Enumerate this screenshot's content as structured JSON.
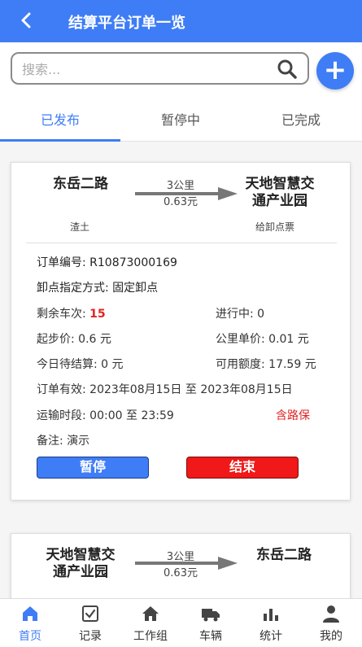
{
  "header": {
    "back_icon": "chevron-left-icon",
    "title": "结算平台订单一览"
  },
  "search": {
    "placeholder": "搜索...",
    "value": ""
  },
  "tabs": [
    {
      "label": "已发布",
      "active": true
    },
    {
      "label": "暂停中",
      "active": false
    },
    {
      "label": "已完成",
      "active": false
    }
  ],
  "orders": [
    {
      "from": "东岳二路",
      "to_line1": "天地智慧交",
      "to_line2": "通产业园",
      "distance_km": "3公里",
      "price": "0.63元",
      "cargo": "渣土",
      "ticket": "给卸点票",
      "order_no_label": "订单编号:",
      "order_no": "R10873000169",
      "unload_label": "卸点指定方式:",
      "unload_mode": "固定卸点",
      "remaining_label": "剩余车次:",
      "remaining": "15",
      "ongoing_label": "进行中:",
      "ongoing": "0",
      "start_price_label": "起步价:",
      "start_price": "0.6 元",
      "unit_price_label": "公里单价:",
      "unit_price": "0.01 元",
      "today_label": "今日待结算:",
      "today": "0 元",
      "quota_label": "可用额度:",
      "quota": "17.59 元",
      "valid_label": "订单有效:",
      "valid_from": "2023年08月15日",
      "to_word": "至",
      "valid_to": "2023年08月15日",
      "period_label": "运输时段:",
      "period_from": "00:00",
      "period_to": "23:59",
      "insurance": "含路保",
      "remark_label": "备注:",
      "remark": "演示",
      "pause_button": "暂停",
      "end_button": "结束"
    },
    {
      "from_line1": "天地智慧交",
      "from_line2": "通产业园",
      "to": "东岳二路",
      "distance_km": "3公里",
      "price": "0.63元"
    }
  ],
  "bottom_nav": [
    {
      "label": "首页",
      "icon": "home-icon",
      "active": true
    },
    {
      "label": "记录",
      "icon": "checklist-icon",
      "active": false
    },
    {
      "label": "工作组",
      "icon": "house-icon",
      "active": false
    },
    {
      "label": "车辆",
      "icon": "truck-icon",
      "active": false
    },
    {
      "label": "统计",
      "icon": "bar-chart-icon",
      "active": false
    },
    {
      "label": "我的",
      "icon": "user-icon",
      "active": false
    }
  ],
  "colors": {
    "primary": "#3f7df6",
    "danger": "#f01818",
    "highlight_red": "#e02424"
  }
}
